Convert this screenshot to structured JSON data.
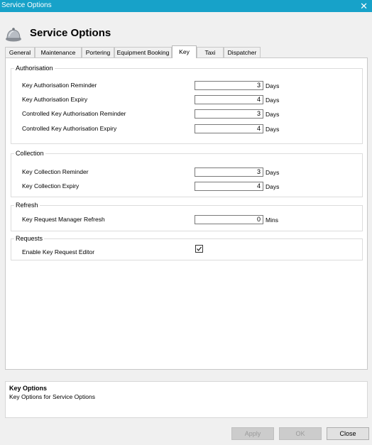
{
  "window": {
    "title": "Service Options",
    "close_glyph": "✕"
  },
  "header": {
    "title": "Service Options",
    "icon": "service-bell-icon"
  },
  "tabs": [
    {
      "label": "General"
    },
    {
      "label": "Maintenance"
    },
    {
      "label": "Portering"
    },
    {
      "label": "Equipment Booking"
    },
    {
      "label": "Key",
      "active": true
    },
    {
      "label": "Taxi"
    },
    {
      "label": "Dispatcher"
    }
  ],
  "groups": {
    "authorisation": {
      "title": "Authorisation",
      "rows": [
        {
          "label": "Key Authorisation Reminder",
          "value": "3",
          "unit": "Days"
        },
        {
          "label": "Key Authorisation Expiry",
          "value": "4",
          "unit": "Days"
        },
        {
          "label": "Controlled Key Authorisation Reminder",
          "value": "3",
          "unit": "Days"
        },
        {
          "label": "Controlled Key Authorisation Expiry",
          "value": "4",
          "unit": "Days"
        }
      ]
    },
    "collection": {
      "title": "Collection",
      "rows": [
        {
          "label": "Key Collection Reminder",
          "value": "3",
          "unit": "Days"
        },
        {
          "label": "Key Collection Expiry",
          "value": "4",
          "unit": "Days"
        }
      ]
    },
    "refresh": {
      "title": "Refresh",
      "rows": [
        {
          "label": "Key Request Manager Refresh",
          "value": "0",
          "unit": "Mins"
        }
      ]
    },
    "requests": {
      "title": "Requests",
      "checkbox_label": "Enable Key Request Editor",
      "checked": true
    }
  },
  "description": {
    "title": "Key Options",
    "text": "Key Options for Service Options"
  },
  "buttons": {
    "apply": "Apply",
    "ok": "OK",
    "close": "Close"
  }
}
